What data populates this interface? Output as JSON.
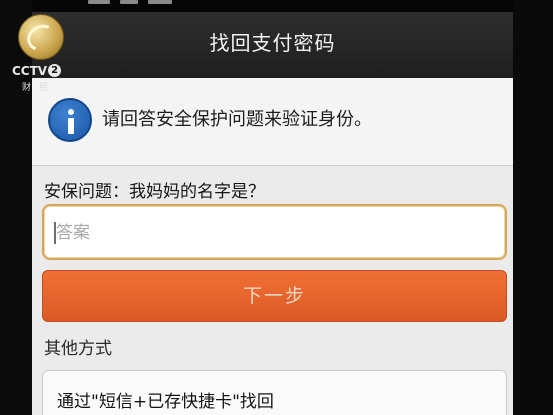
{
  "app": {
    "title": "找回支付密码"
  },
  "info_banner": {
    "icon": "info-icon",
    "text": "请回答安全保护问题来验证身份。",
    "icon_color": "#1b56a8"
  },
  "security_question": {
    "label": "安保问题：我妈妈的名字是？"
  },
  "answer_input": {
    "placeholder": "答案",
    "value": ""
  },
  "next_button": {
    "label": "下一步",
    "color": "#e4622b"
  },
  "other_methods": {
    "label": "其他方式",
    "options": [
      {
        "label": "通过\"短信+已存快捷卡\"找回"
      }
    ]
  },
  "broadcast_logo": {
    "channel": "CCTV",
    "number": "2",
    "subtitle": "财经",
    "icon": "cctv-logo-icon"
  }
}
